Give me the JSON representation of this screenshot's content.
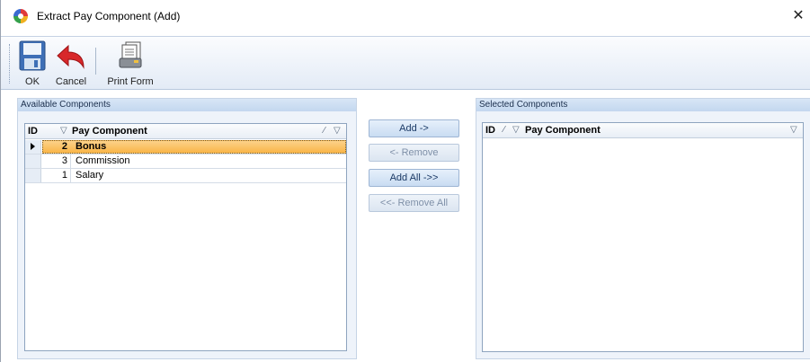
{
  "window": {
    "title": "Extract Pay Component (Add)",
    "close_glyph": "✕"
  },
  "toolbar": {
    "ok_label": "OK",
    "cancel_label": "Cancel",
    "print_label": "Print Form"
  },
  "available": {
    "header": "Available Components",
    "col_id": "ID",
    "col_name": "Pay Component",
    "rows": [
      {
        "id": "2",
        "name": "Bonus"
      },
      {
        "id": "3",
        "name": "Commission"
      },
      {
        "id": "1",
        "name": "Salary"
      }
    ]
  },
  "buttons": {
    "add": "Add ->",
    "remove": "<- Remove",
    "add_all": "Add All ->>",
    "remove_all": "<<- Remove All"
  },
  "selected": {
    "header": "Selected Components",
    "col_id": "ID",
    "col_name": "Pay Component",
    "rows": []
  },
  "icons": {
    "app": "app-logo-icon",
    "ok": "floppy-disk-icon",
    "cancel": "undo-arrow-icon",
    "print": "print-form-icon",
    "filter": "filter-icon",
    "sort": "sort-icon",
    "row_pointer": "row-pointer-icon"
  }
}
